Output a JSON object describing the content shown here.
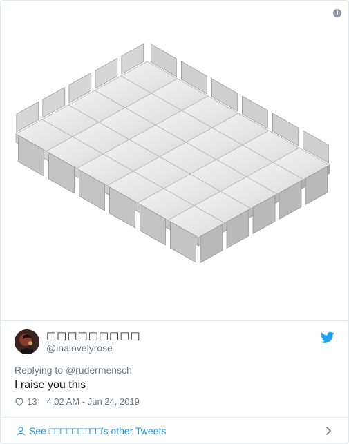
{
  "tweet": {
    "display_name": "□□□□□□□□□",
    "handle": "@inalovelyrose",
    "reply_prefix": "Replying to",
    "reply_to": "@rudermensch",
    "text": "I raise you this",
    "likes": "13",
    "timestamp": "4:02 AM - Jun 24, 2019"
  },
  "footer": {
    "label": "See □□□□□□□□□'s other Tweets"
  },
  "icons": {
    "info": "info-icon",
    "bird": "twitter-bird-icon",
    "heart": "heart-icon",
    "person": "person-icon",
    "chevron": "chevron-right-icon"
  },
  "colors": {
    "link_blue": "#1b95e0",
    "muted": "#657786",
    "border": "#e1e8ed",
    "twitter_blue": "#1da1f2"
  }
}
